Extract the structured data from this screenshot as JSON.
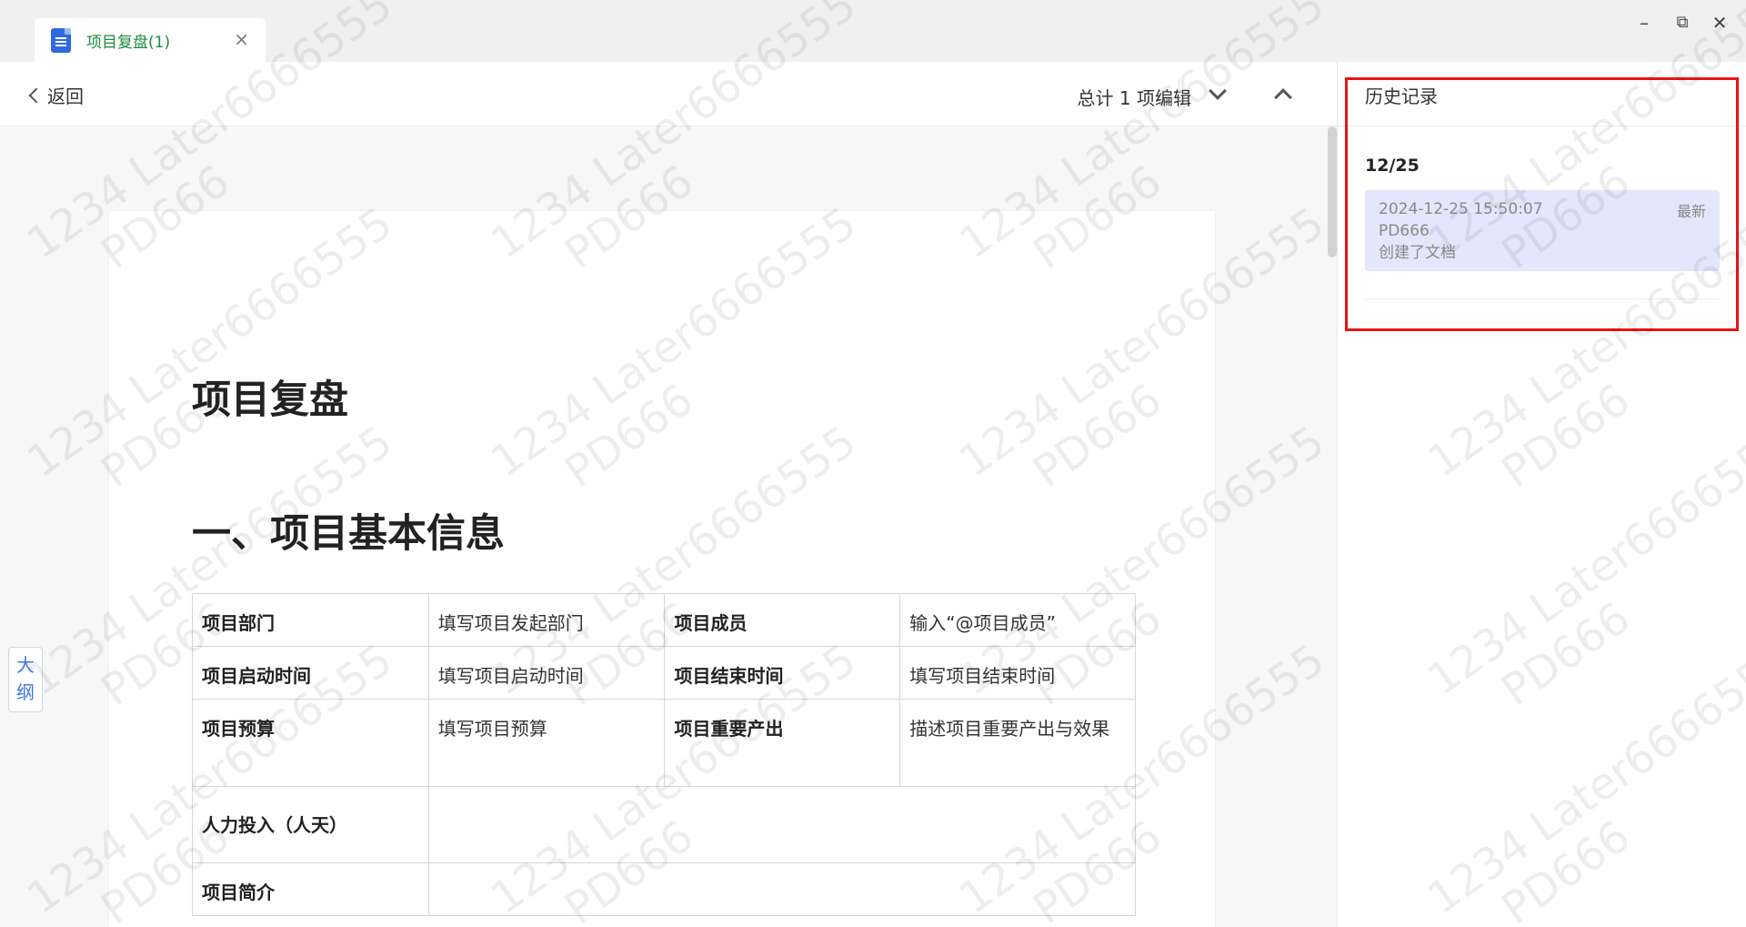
{
  "tab": {
    "title": "项目复盘(1)",
    "close": "×"
  },
  "window_controls": {
    "minimize": "–",
    "restore": "⧉",
    "close": "✕"
  },
  "toolbar": {
    "back_label": "返回",
    "edit_count": "总计 1 项编辑"
  },
  "document": {
    "title": "项目复盘",
    "heading": "一、项目基本信息",
    "table": {
      "r1": {
        "k1": "项目部门",
        "v1": "填写项目发起部门",
        "k2": "项目成员",
        "v2": "输入“@项目成员”"
      },
      "r2": {
        "k1": "项目启动时间",
        "v1": "填写项目启动时间",
        "k2": "项目结束时间",
        "v2": "填写项目结束时间"
      },
      "r3": {
        "k1": "项目预算",
        "v1": "填写项目预算",
        "k2": "项目重要产出",
        "v2": "描述项目重要产出与效果"
      },
      "r4": {
        "k1": "人力投入（人天）",
        "v1": ""
      },
      "r5": {
        "k1": "项目简介",
        "v1": ""
      }
    }
  },
  "outline_button": "大纲",
  "history": {
    "title": "历史记录",
    "date_group": "12/25",
    "record": {
      "time": "2024-12-25 15:50:07",
      "user": "PD666",
      "action": "创建了文档",
      "badge": "最新"
    }
  },
  "watermark": {
    "line1": "1234 Later6666555",
    "line2": "PD666"
  }
}
